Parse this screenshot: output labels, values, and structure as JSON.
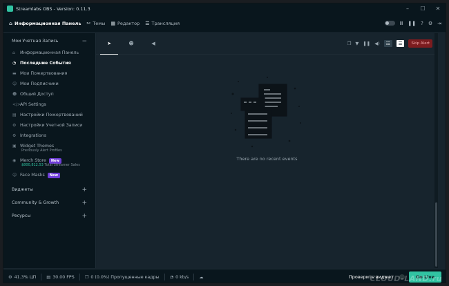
{
  "window": {
    "title": "Streamlabs OBS - Version: 0.11.3"
  },
  "topnav": {
    "items": [
      {
        "label": "Информационная Панель",
        "icon": "home-icon",
        "glyph": "⌂",
        "active": true
      },
      {
        "label": "Темы",
        "icon": "theme-icon",
        "glyph": "✂",
        "active": false
      },
      {
        "label": "Редактор",
        "icon": "studio-icon",
        "glyph": "▦",
        "active": false
      },
      {
        "label": "Трансляция",
        "icon": "live-icon",
        "glyph": "☰",
        "active": false
      }
    ]
  },
  "sidebar": {
    "account_header": "Мои Учетная Запись",
    "items": [
      {
        "label": "Информационная Панель",
        "icon": "home-icon",
        "glyph": "⌂"
      },
      {
        "label": "Последние События",
        "icon": "clock-icon",
        "glyph": "◔",
        "active": true
      },
      {
        "label": "Мои Пожертвования",
        "icon": "donation-icon",
        "glyph": "▬"
      },
      {
        "label": "Мои Подписчики",
        "icon": "users-icon",
        "glyph": "☺"
      },
      {
        "label": "Общий Доступ",
        "icon": "share-icon",
        "glyph": "☻"
      },
      {
        "label": "API Settings",
        "icon": "code-icon",
        "glyph": "</>"
      },
      {
        "label": "Настройки Пожертвований",
        "icon": "sliders-icon",
        "glyph": "▤"
      },
      {
        "label": "Настройки Учетной Записи",
        "icon": "gear-icon",
        "glyph": "⚙"
      },
      {
        "label": "Integrations",
        "icon": "integrations-icon",
        "glyph": "⚙"
      },
      {
        "label": "Widget Themes",
        "icon": "widget-icon",
        "glyph": "▣",
        "sub": "Previously Alert Profiles"
      },
      {
        "label": "Merch Store",
        "icon": "cart-icon",
        "glyph": "◉",
        "badge": "New",
        "sub_money": "$800,812.53",
        "sub_text": "Total Streamer Sales"
      },
      {
        "label": "Face Masks",
        "icon": "mask-icon",
        "glyph": "☺",
        "badge": "New"
      }
    ],
    "sections": [
      {
        "label": "Виджеты"
      },
      {
        "label": "Community & Growth"
      },
      {
        "label": "Ресурсы"
      }
    ]
  },
  "main": {
    "tabs": [
      {
        "icon": "send-icon",
        "glyph": "➤",
        "active": true
      },
      {
        "icon": "bot-icon",
        "glyph": "☻",
        "active": false
      },
      {
        "icon": "megaphone-icon",
        "glyph": "◀",
        "active": false
      }
    ],
    "skip_alert": "Skip Alert",
    "empty_text": "There are no recent events"
  },
  "status": {
    "cpu": "41.3% ЦП",
    "fps": "30.00 FPS",
    "dropped": "0 (0.0%) Пропущенные кадры",
    "bitrate": "0 kb/s",
    "test_widget": "Проверить виджет",
    "go_live": "Go Live"
  },
  "watermark": "CLOUD-LAND.ru"
}
